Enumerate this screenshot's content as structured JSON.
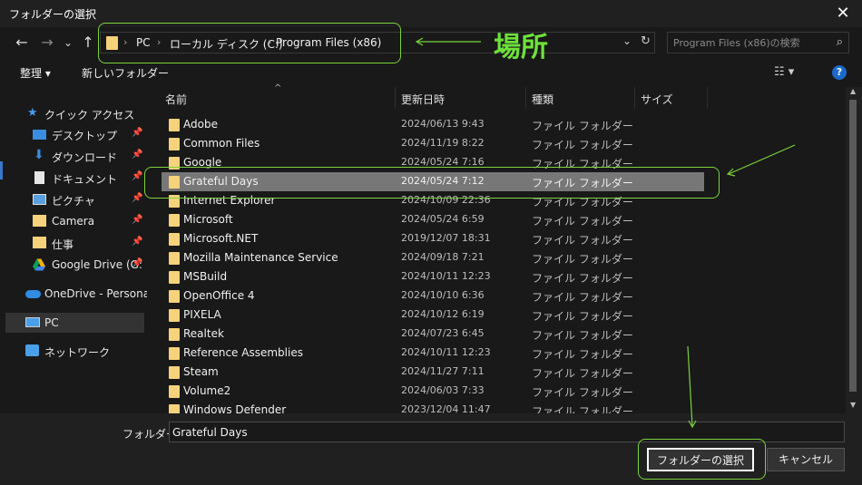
{
  "window": {
    "title": "フォルダーの選択",
    "close_glyph": "✕"
  },
  "nav": {
    "back": "←",
    "forward": "→",
    "recent": "⌄",
    "up": "↑"
  },
  "address": {
    "crumbs": [
      "PC",
      "ローカル ディスク (C:)",
      "Program Files (x86)"
    ],
    "sep": "›"
  },
  "search": {
    "placeholder": "Program Files (x86)の検索"
  },
  "annotation": {
    "location_label": "場所"
  },
  "toolbar": {
    "organize": "整理 ▾",
    "new_folder": "新しいフォルダー"
  },
  "navpane": {
    "items": [
      {
        "label": "クイック アクセス",
        "icon": "star-icon"
      },
      {
        "label": "デスクトップ",
        "icon": "desktop-icon"
      },
      {
        "label": "ダウンロード",
        "icon": "download-icon"
      },
      {
        "label": "ドキュメント",
        "icon": "document-icon"
      },
      {
        "label": "ピクチャ",
        "icon": "picture-icon"
      },
      {
        "label": "Camera",
        "icon": "folder-icon"
      },
      {
        "label": "仕事",
        "icon": "folder-icon"
      },
      {
        "label": "Google Drive (G:",
        "icon": "google-drive-icon"
      },
      {
        "label": "OneDrive - Personal",
        "icon": "onedrive-icon"
      },
      {
        "label": "PC",
        "icon": "pc-icon"
      },
      {
        "label": "ネットワーク",
        "icon": "network-icon"
      }
    ]
  },
  "columns": {
    "name": "名前",
    "date": "更新日時",
    "type": "種類",
    "size": "サイズ"
  },
  "files": [
    {
      "name": "Adobe",
      "date": "2024/06/13 9:43",
      "type": "ファイル フォルダー"
    },
    {
      "name": "Common Files",
      "date": "2024/11/19 8:22",
      "type": "ファイル フォルダー"
    },
    {
      "name": "Google",
      "date": "2024/05/24 7:16",
      "type": "ファイル フォルダー"
    },
    {
      "name": "Grateful Days",
      "date": "2024/05/24 7:12",
      "type": "ファイル フォルダー"
    },
    {
      "name": "Internet Explorer",
      "date": "2024/10/09 22:36",
      "type": "ファイル フォルダー"
    },
    {
      "name": "Microsoft",
      "date": "2024/05/24 6:59",
      "type": "ファイル フォルダー"
    },
    {
      "name": "Microsoft.NET",
      "date": "2019/12/07 18:31",
      "type": "ファイル フォルダー"
    },
    {
      "name": "Mozilla Maintenance Service",
      "date": "2024/09/18 7:21",
      "type": "ファイル フォルダー"
    },
    {
      "name": "MSBuild",
      "date": "2024/10/11 12:23",
      "type": "ファイル フォルダー"
    },
    {
      "name": "OpenOffice 4",
      "date": "2024/10/10 6:36",
      "type": "ファイル フォルダー"
    },
    {
      "name": "PIXELA",
      "date": "2024/10/12 6:19",
      "type": "ファイル フォルダー"
    },
    {
      "name": "Realtek",
      "date": "2024/07/23 6:45",
      "type": "ファイル フォルダー"
    },
    {
      "name": "Reference Assemblies",
      "date": "2024/10/11 12:23",
      "type": "ファイル フォルダー"
    },
    {
      "name": "Steam",
      "date": "2024/11/27 7:11",
      "type": "ファイル フォルダー"
    },
    {
      "name": "Volume2",
      "date": "2024/06/03 7:33",
      "type": "ファイル フォルダー"
    },
    {
      "name": "Windows Defender",
      "date": "2023/12/04 11:47",
      "type": "ファイル フォルダー"
    }
  ],
  "bottom": {
    "folder_label": "フォルダー:",
    "folder_value": "Grateful Days",
    "select_button": "フォルダーの選択",
    "cancel_button": "キャンセル"
  }
}
